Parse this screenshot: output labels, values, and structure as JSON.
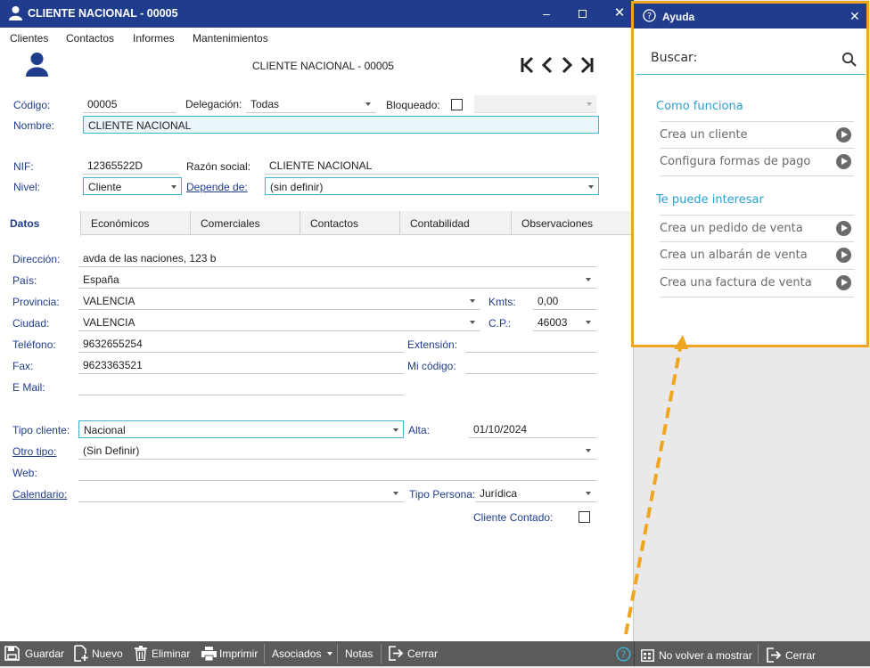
{
  "window": {
    "title": "CLIENTE NACIONAL - 00005"
  },
  "menu": [
    "Clientes",
    "Contactos",
    "Informes",
    "Mantenimientos"
  ],
  "header": {
    "record_title": "CLIENTE NACIONAL - 00005"
  },
  "form": {
    "codigo_label": "Código:",
    "codigo": "00005",
    "delegacion_label": "Delegación:",
    "delegacion": "Todas",
    "bloqueado_label": "Bloqueado:",
    "nombre_label": "Nombre:",
    "nombre": "CLIENTE NACIONAL",
    "nif_label": "NIF:",
    "nif": "12365522D",
    "razon_label": "Razón social:",
    "razon": "CLIENTE NACIONAL",
    "nivel_label": "Nivel:",
    "nivel": "Cliente",
    "depende_label": "Depende de:",
    "depende": "(sin definir)"
  },
  "tabs": [
    "Datos",
    "Económicos",
    "Comerciales",
    "Contactos",
    "Contabilidad",
    "Observaciones"
  ],
  "datos": {
    "direccion_label": "Dirección:",
    "direccion": "avda de las naciones, 123 b",
    "pais_label": "País:",
    "pais": "España",
    "provincia_label": "Provincia:",
    "provincia": "VALENCIA",
    "kmts_label": "Kmts:",
    "kmts": "0,00",
    "ciudad_label": "Ciudad:",
    "ciudad": "VALENCIA",
    "cp_label": "C.P.:",
    "cp": "46003",
    "telefono_label": "Teléfono:",
    "telefono": "9632655254",
    "extension_label": "Extensión:",
    "fax_label": "Fax:",
    "fax": "9623363521",
    "micodigo_label": "Mi código:",
    "email_label": "E Mail:",
    "tipocliente_label": "Tipo cliente:",
    "tipocliente": "Nacional",
    "alta_label": "Alta:",
    "alta": "01/10/2024",
    "otrotipo_label": "Otro tipo:",
    "otrotipo": "(Sin Definir)",
    "web_label": "Web:",
    "calendario_label": "Calendario:",
    "tipopersona_label": "Tipo Persona:",
    "tipopersona": "Jurídica",
    "contado_label": "Cliente Contado:"
  },
  "toolbar": {
    "guardar": "Guardar",
    "nuevo": "Nuevo",
    "eliminar": "Eliminar",
    "imprimir": "Imprimir",
    "asociados": "Asociados",
    "notas": "Notas",
    "cerrar": "Cerrar",
    "no_volver": "No volver a mostrar",
    "cerrar_help": "Cerrar"
  },
  "help": {
    "title": "Ayuda",
    "search_label": "Buscar:",
    "section1": "Como funciona",
    "items1": [
      "Crea un cliente",
      "Configura formas de pago"
    ],
    "section2": "Te puede interesar",
    "items2": [
      "Crea un pedido de venta",
      "Crea un albarán de venta",
      "Crea una factura de venta"
    ]
  },
  "colors": {
    "titlebar": "#1f3d8c",
    "accent": "#2c9fd0",
    "highlight": "#f0a51f",
    "toolbar": "#5b5b5b"
  }
}
